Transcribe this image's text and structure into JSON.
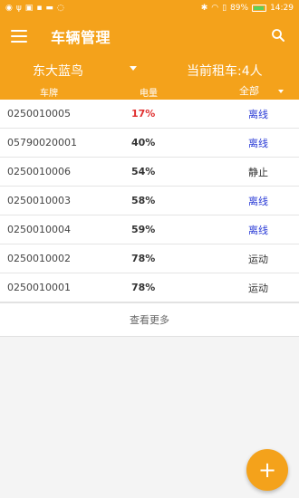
{
  "statusbar": {
    "battery": "89%",
    "time": "14:29",
    "battery_level": 0.89
  },
  "appbar": {
    "title": "车辆管理"
  },
  "filter": {
    "station": "东大蓝鸟",
    "renters": "当前租车:4人",
    "col_plate": "车牌",
    "col_power": "电量",
    "col_status": "全部"
  },
  "vehicles": [
    {
      "plate": "0250010005",
      "power": "17%",
      "status": "离线"
    },
    {
      "plate": "05790020001",
      "power": "40%",
      "status": "离线"
    },
    {
      "plate": "0250010006",
      "power": "54%",
      "status": "静止"
    },
    {
      "plate": "0250010003",
      "power": "58%",
      "status": "离线"
    },
    {
      "plate": "0250010004",
      "power": "59%",
      "status": "离线"
    },
    {
      "plate": "0250010002",
      "power": "78%",
      "status": "运动"
    },
    {
      "plate": "0250010001",
      "power": "78%",
      "status": "运动"
    }
  ],
  "more_label": "查看更多",
  "fab_label": "+",
  "colors": {
    "accent": "#f4a21b",
    "low_power": "#e03030",
    "offline": "#2a3bd6"
  }
}
